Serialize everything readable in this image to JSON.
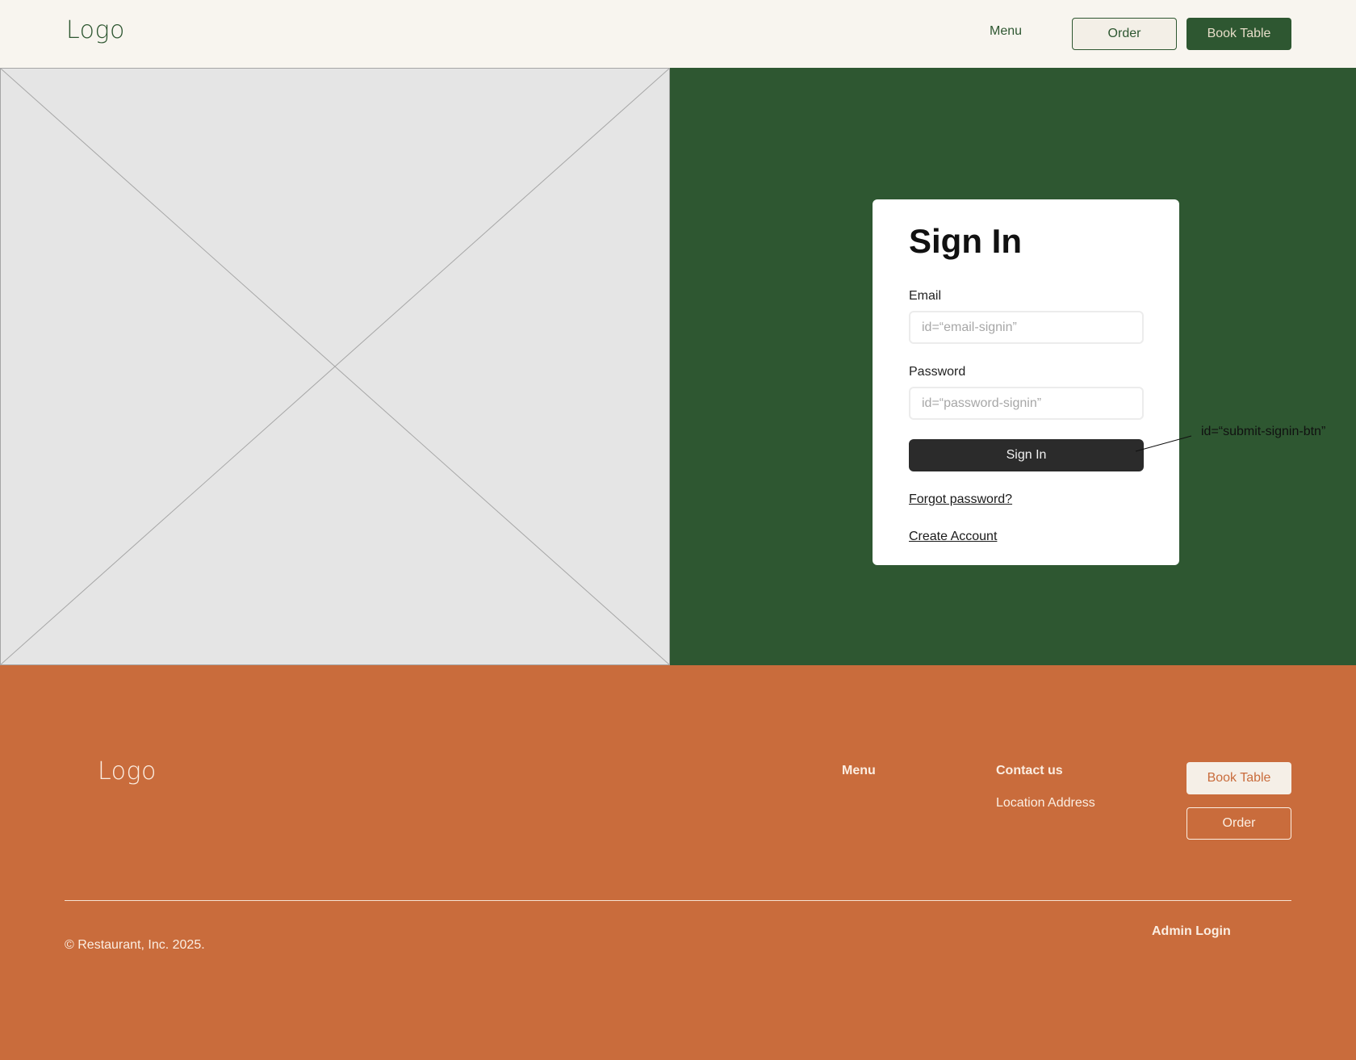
{
  "header": {
    "logo": "Logo",
    "nav_menu": "Menu",
    "order_label": "Order",
    "book_table_label": "Book Table"
  },
  "signin": {
    "title": "Sign In",
    "email_label": "Email",
    "email_placeholder": "id=“email-signin”",
    "password_label": "Password",
    "password_placeholder": "id=“password-signin”",
    "submit_label": "Sign In",
    "forgot_password": "Forgot password?",
    "create_account": "Create Account"
  },
  "annotation": {
    "text": "id=“submit-signin-btn”"
  },
  "footer": {
    "logo": "Logo",
    "menu_title": "Menu",
    "contact_title": "Contact us",
    "address": "Location Address",
    "book_table_label": "Book Table",
    "order_label": "Order",
    "copyright": "© Restaurant, Inc. 2025.",
    "admin_login": "Admin Login"
  },
  "colors": {
    "header_bg": "#f8f5ef",
    "brand_green": "#2e5731",
    "brand_orange": "#c96c3c",
    "placeholder_bg": "#e5e5e5",
    "button_dark": "#2b2b2b"
  }
}
